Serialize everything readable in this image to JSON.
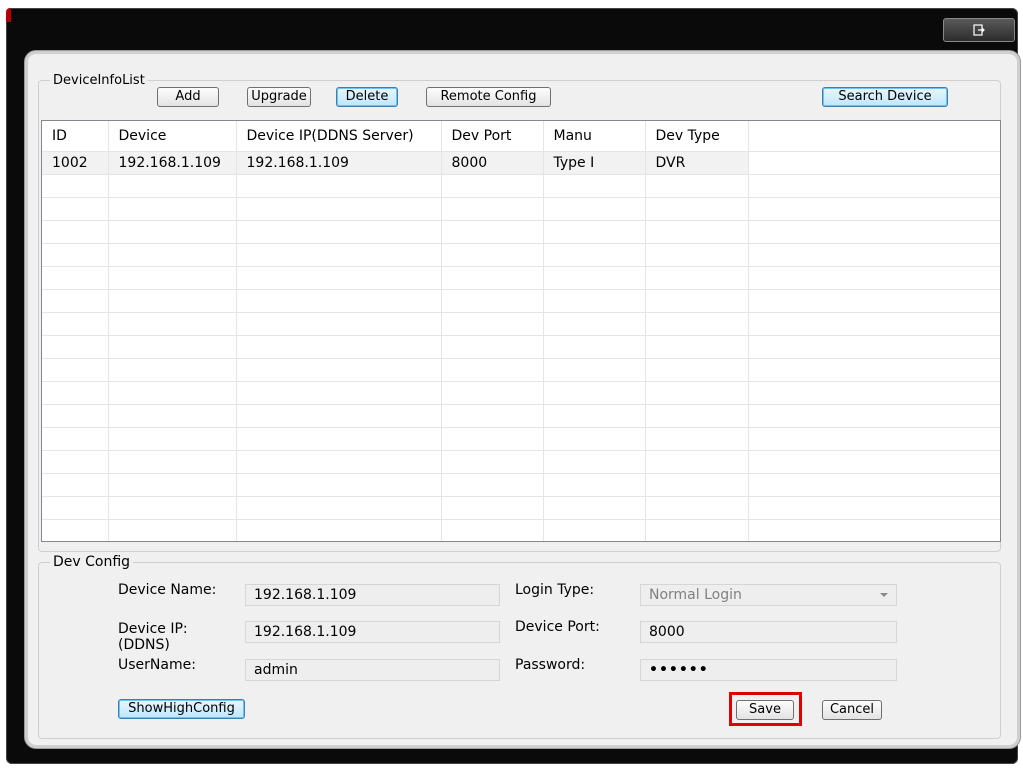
{
  "device_info_list": {
    "title": "DeviceInfoList",
    "buttons": {
      "add": "Add",
      "upgrade": "Upgrade",
      "delete": "Delete",
      "remote_config": "Remote Config",
      "search_device": "Search Device"
    },
    "columns": [
      "ID",
      "Device",
      "Device IP(DDNS Server)",
      "Dev Port",
      "Manu",
      "Dev Type"
    ],
    "rows": [
      [
        "1002",
        "192.168.1.109",
        "192.168.1.109",
        "8000",
        "Type I",
        "DVR"
      ]
    ]
  },
  "dev_config": {
    "title": "Dev Config",
    "device_name_label": "Device Name:",
    "device_name_value": "192.168.1.109",
    "device_ip_label_1": "Device IP:",
    "device_ip_label_2": "(DDNS)",
    "device_ip_value": "192.168.1.109",
    "username_label": "UserName:",
    "username_value": "admin",
    "login_type_label": "Login Type:",
    "login_type_value": "Normal Login",
    "device_port_label": "Device Port:",
    "device_port_value": "8000",
    "password_label": "Password:",
    "password_value": "••••••",
    "show_high_config": "ShowHighConfig",
    "save": "Save",
    "cancel": "Cancel"
  },
  "window": {
    "exit_icon": "exit-icon"
  },
  "colors": {
    "highlight": "#e00000",
    "frame": "#0a0a0a"
  }
}
